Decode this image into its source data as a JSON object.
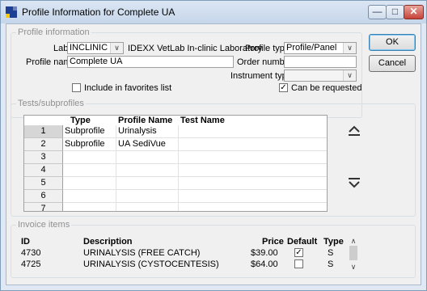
{
  "window": {
    "title": "Profile Information for Complete UA"
  },
  "profile_info": {
    "legend": "Profile information",
    "lab_label": "Lab:",
    "lab_value": "INCLINIC",
    "lab_description": "IDEXX VetLab In-clinic Laboratory",
    "profile_name_label": "Profile name:",
    "profile_name_value": "Complete UA",
    "profile_type_label": "Profile type:",
    "profile_type_value": "Profile/Panel",
    "order_number_label": "Order number:",
    "order_number_value": "",
    "instrument_type_label": "Instrument type:",
    "instrument_type_value": "",
    "favorites_label": "Include in favorites list",
    "favorites_checked": false,
    "can_be_requested_label": "Can be requested",
    "can_be_requested_checked": true
  },
  "buttons": {
    "ok": "OK",
    "cancel": "Cancel"
  },
  "tests": {
    "legend": "Tests/subprofiles",
    "headers": {
      "type": "Type",
      "profile_name": "Profile Name",
      "test_name": "Test Name"
    },
    "rows": [
      {
        "num": "1",
        "type": "Subprofile",
        "profile_name": "Urinalysis",
        "test_name": ""
      },
      {
        "num": "2",
        "type": "Subprofile",
        "profile_name": "UA SediVue",
        "test_name": ""
      },
      {
        "num": "3",
        "type": "",
        "profile_name": "",
        "test_name": ""
      },
      {
        "num": "4",
        "type": "",
        "profile_name": "",
        "test_name": ""
      },
      {
        "num": "5",
        "type": "",
        "profile_name": "",
        "test_name": ""
      },
      {
        "num": "6",
        "type": "",
        "profile_name": "",
        "test_name": ""
      },
      {
        "num": "7",
        "type": "",
        "profile_name": "",
        "test_name": ""
      }
    ]
  },
  "invoice": {
    "legend": "Invoice items",
    "headers": {
      "id": "ID",
      "description": "Description",
      "price": "Price",
      "default": "Default",
      "type": "Type"
    },
    "rows": [
      {
        "id": "4730",
        "description": "URINALYSIS (FREE CATCH)",
        "price": "$39.00",
        "default": true,
        "type": "S"
      },
      {
        "id": "4725",
        "description": "URINALYSIS (CYSTOCENTESIS)",
        "price": "$64.00",
        "default": false,
        "type": "S"
      }
    ]
  },
  "icons": {
    "move_up": "move-up-icon",
    "move_down": "move-down-icon",
    "dropdown": "chevron-down-icon",
    "app": "app-icon"
  },
  "colors": {
    "title_bar": "#c6d6ea",
    "close_button": "#c7443a",
    "selected_row_header": "#d6d6d6"
  }
}
